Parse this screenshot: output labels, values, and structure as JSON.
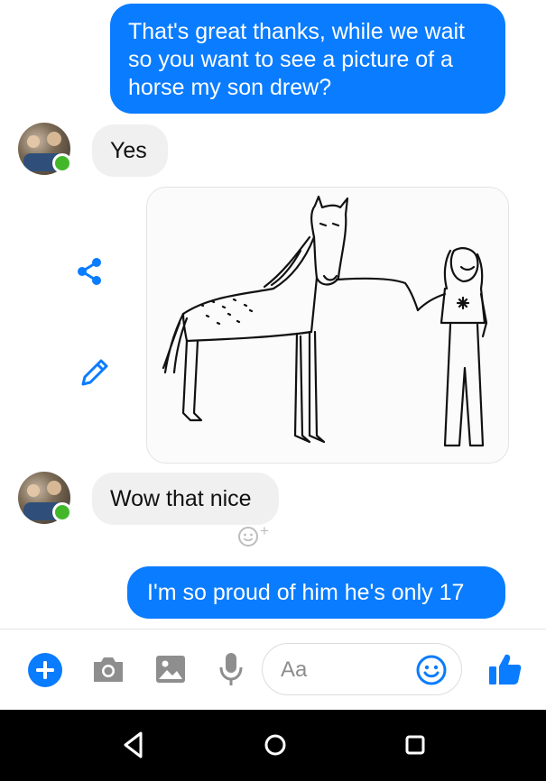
{
  "messages": [
    {
      "side": "out",
      "text": "That's great thanks, while we wait so you want to see a picture of a horse my son drew?"
    },
    {
      "side": "in",
      "text": "Yes"
    },
    {
      "side": "in",
      "text": "Wow that nice"
    },
    {
      "side": "out",
      "text": "I'm so proud of him he's only 17"
    }
  ],
  "reaction_plus": "+",
  "composer": {
    "placeholder": "Aa"
  },
  "colors": {
    "accent": "#0a7cff",
    "incoming_bubble": "#f0f0f0",
    "online": "#42b72a"
  },
  "icons": [
    "share-icon",
    "edit-pencil-icon",
    "add-reaction-icon",
    "plus-icon",
    "camera-icon",
    "gallery-icon",
    "microphone-icon",
    "emoji-icon",
    "thumbs-up-icon",
    "back-icon",
    "home-icon",
    "recents-icon"
  ]
}
